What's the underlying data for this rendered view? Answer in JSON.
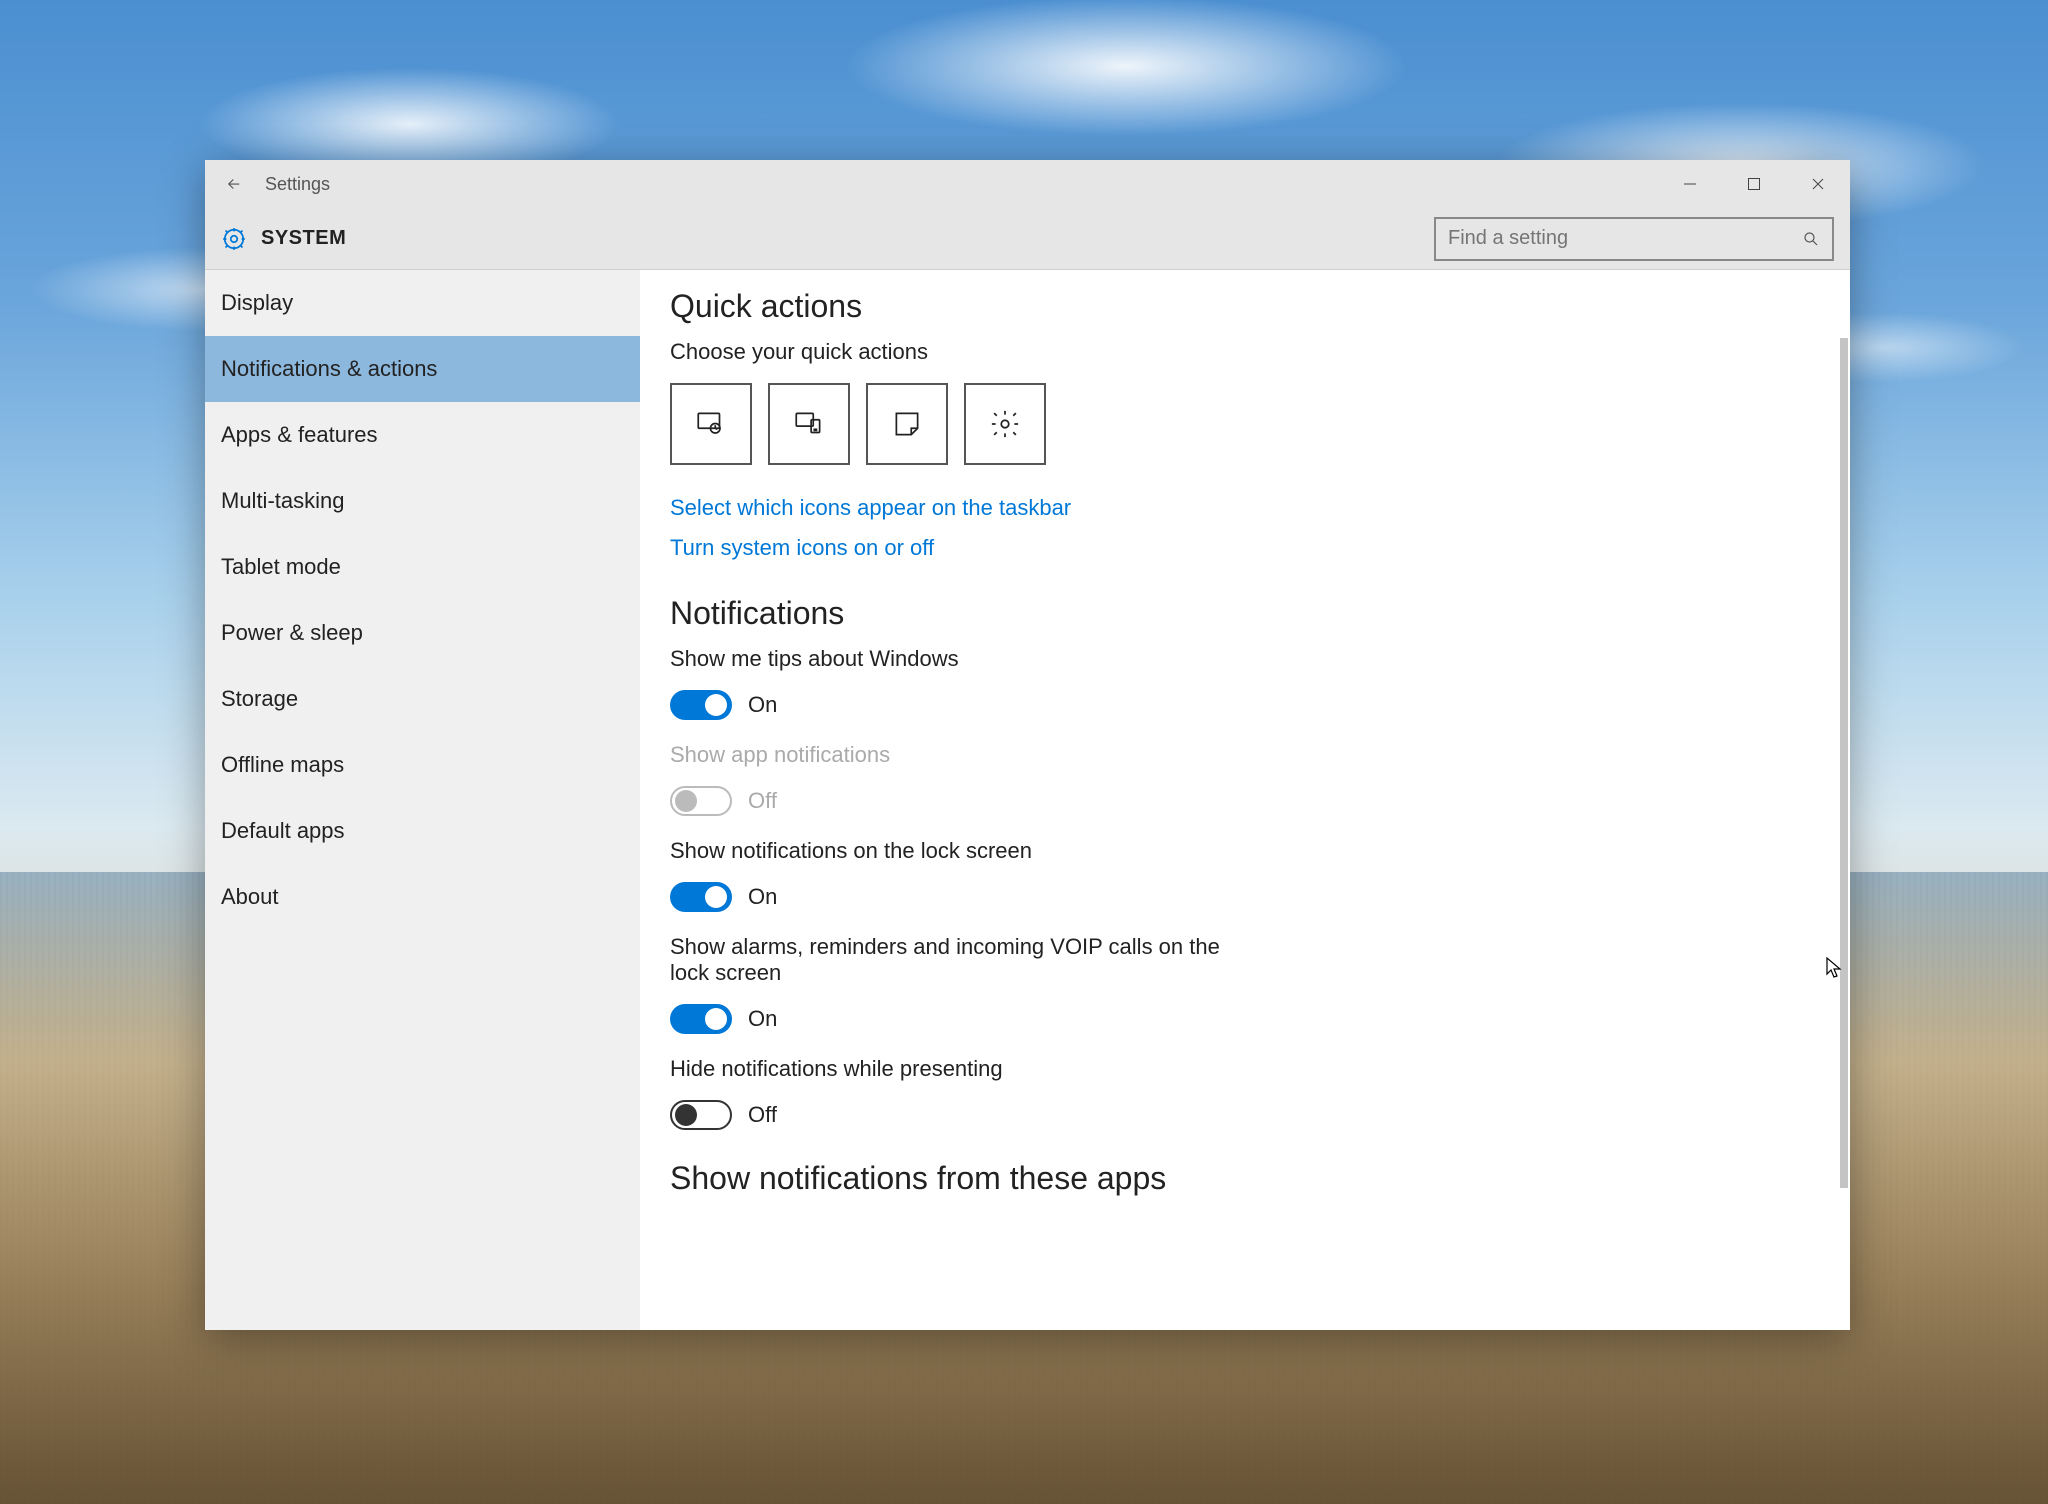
{
  "window": {
    "title": "Settings",
    "header_title": "SYSTEM",
    "search_placeholder": "Find a setting"
  },
  "sidebar": {
    "items": [
      {
        "label": "Display",
        "active": false
      },
      {
        "label": "Notifications & actions",
        "active": true
      },
      {
        "label": "Apps & features",
        "active": false
      },
      {
        "label": "Multi-tasking",
        "active": false
      },
      {
        "label": "Tablet mode",
        "active": false
      },
      {
        "label": "Power & sleep",
        "active": false
      },
      {
        "label": "Storage",
        "active": false
      },
      {
        "label": "Offline maps",
        "active": false
      },
      {
        "label": "Default apps",
        "active": false
      },
      {
        "label": "About",
        "active": false
      }
    ]
  },
  "content": {
    "quick_actions": {
      "title": "Quick actions",
      "subtitle": "Choose your quick actions",
      "tiles": [
        {
          "icon": "tablet-mode-icon"
        },
        {
          "icon": "connect-icon"
        },
        {
          "icon": "note-icon"
        },
        {
          "icon": "settings-icon"
        }
      ],
      "link_taskbar": "Select which icons appear on the taskbar",
      "link_system_icons": "Turn system icons on or off"
    },
    "notifications": {
      "title": "Notifications",
      "toggles": [
        {
          "label": "Show me tips about Windows",
          "state": "On",
          "on": true,
          "disabled": false
        },
        {
          "label": "Show app notifications",
          "state": "Off",
          "on": false,
          "disabled": true
        },
        {
          "label": "Show notifications on the lock screen",
          "state": "On",
          "on": true,
          "disabled": false
        },
        {
          "label": "Show alarms, reminders and incoming VOIP calls on the lock screen",
          "state": "On",
          "on": true,
          "disabled": false
        },
        {
          "label": "Hide notifications while presenting",
          "state": "Off",
          "on": false,
          "disabled": false
        }
      ]
    },
    "apps_section_title": "Show notifications from these apps"
  }
}
